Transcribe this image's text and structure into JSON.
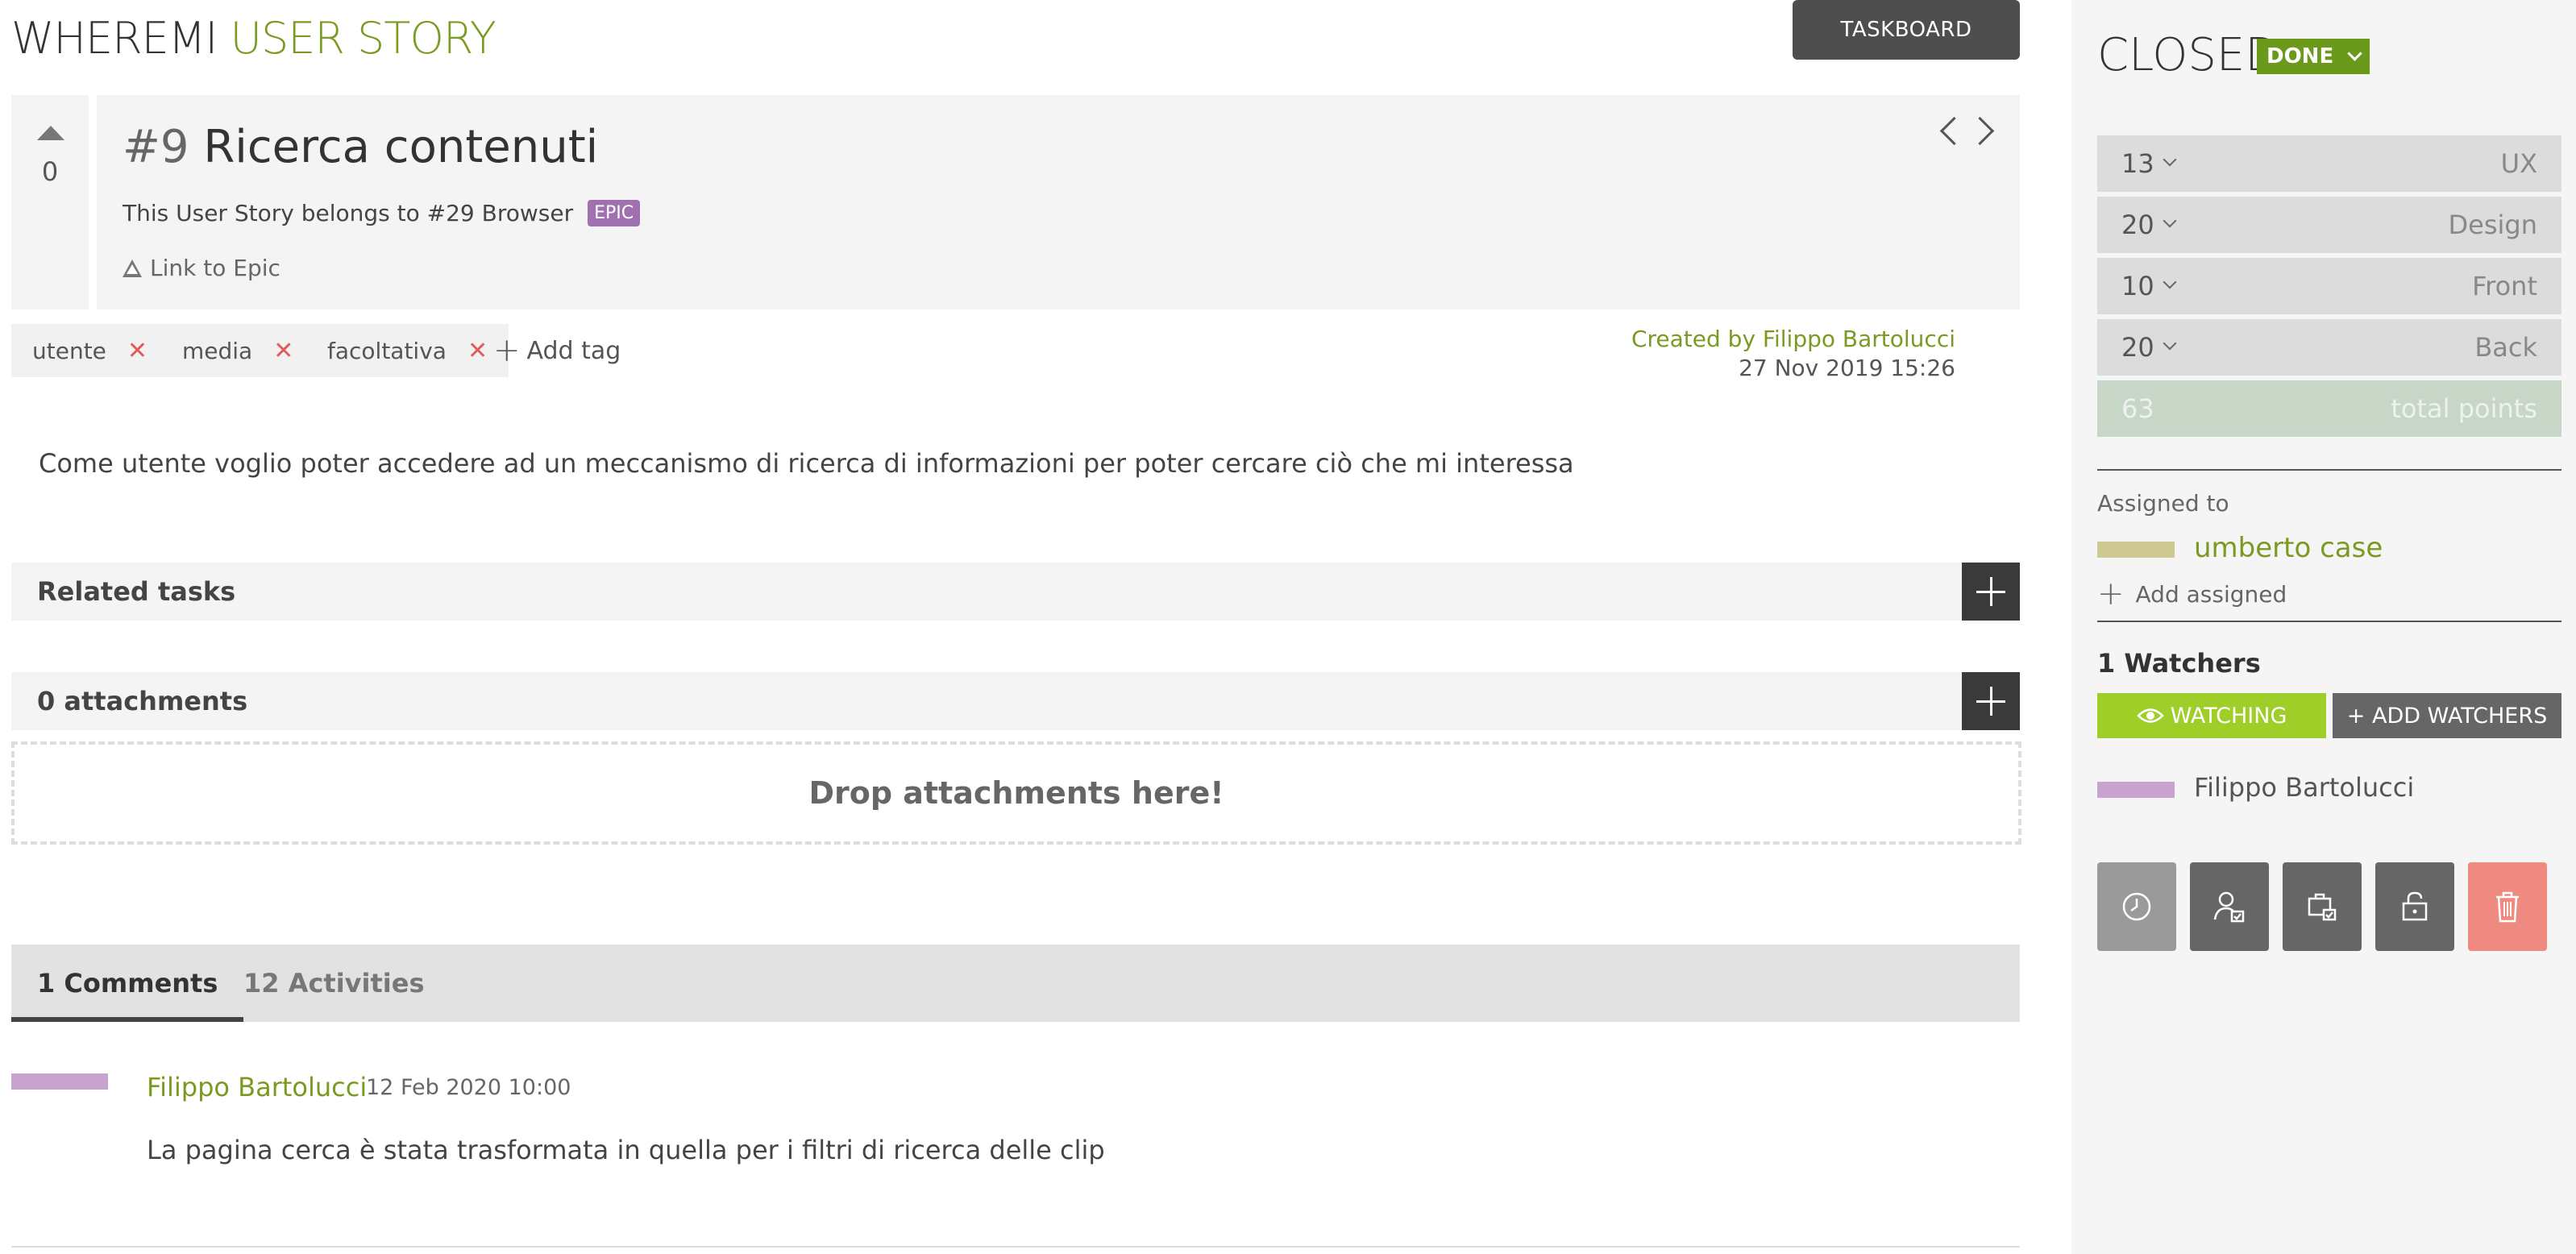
{
  "header": {
    "project": "WHEREMI",
    "section": "USER STORY",
    "taskboard_label": "TASKBOARD"
  },
  "story": {
    "votes": "0",
    "ref": "#9",
    "title": "Ricerca contenuti",
    "belongs_text": "This User Story belongs to #29 Browser",
    "epic_badge": "EPIC",
    "link_epic": "Link to Epic",
    "tags": [
      {
        "label": "utente"
      },
      {
        "label": "media"
      },
      {
        "label": "facoltativa"
      }
    ],
    "add_tag": "Add tag",
    "created_by": "Created by Filippo Bartolucci",
    "created_date": "27 Nov 2019 15:26",
    "description": "Come utente voglio poter accedere ad un meccanismo di ricerca di informazioni per poter cercare ciò che mi interessa"
  },
  "sections": {
    "related_tasks": "Related tasks",
    "attachments": "0 attachments",
    "dropzone": "Drop attachments here!"
  },
  "tabs": [
    {
      "label": "1 Comments",
      "active": true
    },
    {
      "label": "12 Activities",
      "active": false
    }
  ],
  "comment": {
    "author": "Filippo Bartolucci",
    "date": "12 Feb 2020 10:00",
    "text": "La pagina cerca è stata trasformata in quella per i filtri di ricerca delle clip"
  },
  "sidebar": {
    "status_title": "CLOSED",
    "status_value": "DONE",
    "points": [
      {
        "value": "13",
        "role": "UX"
      },
      {
        "value": "20",
        "role": "Design"
      },
      {
        "value": "10",
        "role": "Front"
      },
      {
        "value": "20",
        "role": "Back"
      }
    ],
    "total": {
      "value": "63",
      "role": "total points"
    },
    "assigned_label": "Assigned to",
    "assigned_name": "umberto case",
    "add_assigned": "Add assigned",
    "watchers_label": "1 Watchers",
    "watching_label": "WATCHING",
    "add_watchers_label": "+ ADD WATCHERS",
    "watcher_name": "Filippo Bartolucci",
    "actions": [
      {
        "icon": "clock-icon",
        "color": "#9a9a9a"
      },
      {
        "icon": "user-check-icon",
        "color": "#666666"
      },
      {
        "icon": "briefcase-check-icon",
        "color": "#666666"
      },
      {
        "icon": "lock-icon",
        "color": "#666666"
      },
      {
        "icon": "trash-icon",
        "color": "#ef8a80"
      }
    ]
  }
}
